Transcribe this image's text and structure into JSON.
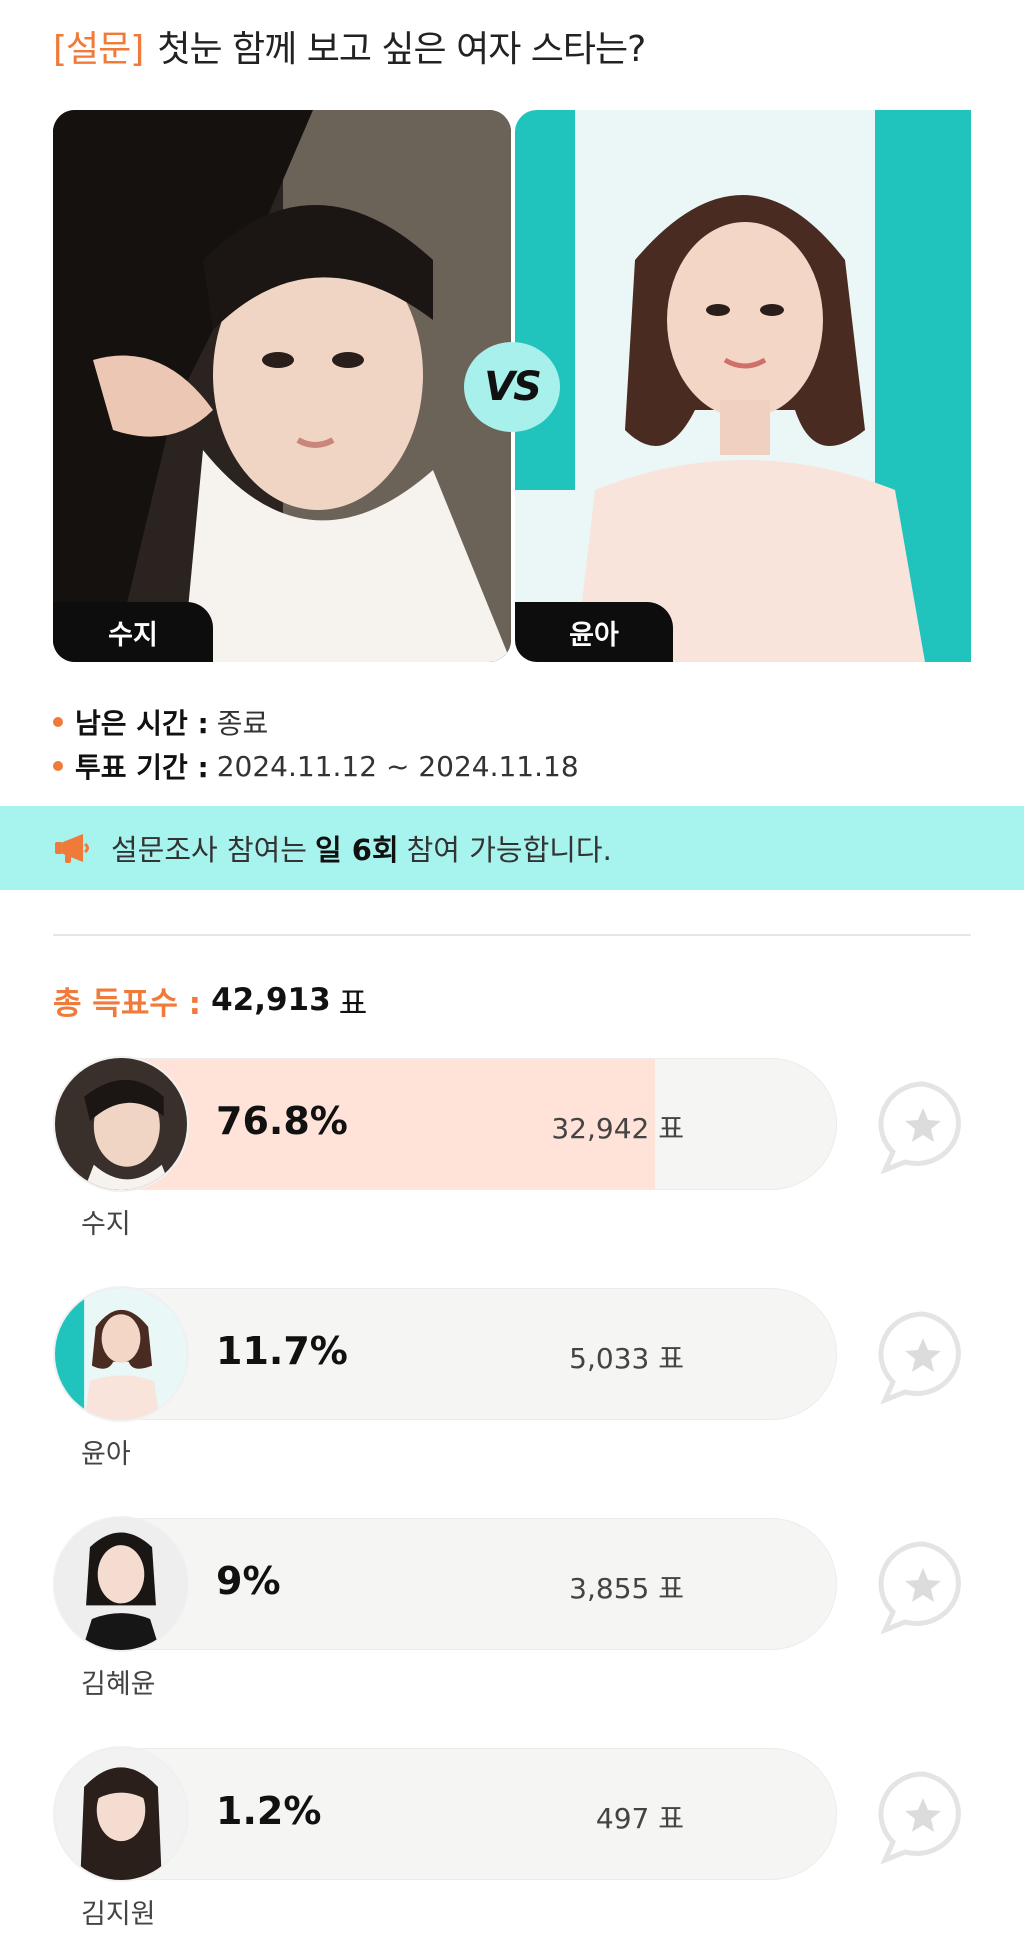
{
  "header": {
    "tag": "[설문]",
    "title": "첫눈 함께 보고 싶은 여자 스타는?"
  },
  "matchup": {
    "left_name": "수지",
    "right_name": "윤아",
    "vs_label": "VS"
  },
  "info": {
    "remaining_label": "남은 시간 :",
    "remaining_value": "종료",
    "period_label": "투표 기간 :",
    "period_value": "2024.11.12 ~ 2024.11.18"
  },
  "notice": {
    "icon": "megaphone-icon",
    "text_before": "설문조사 참여는",
    "text_bold": "일 6회",
    "text_after": "참여 가능합니다."
  },
  "total": {
    "label": "총 득표수 :",
    "value": "42,913",
    "unit": "표"
  },
  "results": [
    {
      "name": "수지",
      "percent_label": "76.8%",
      "percent": 76.8,
      "votes": "32,942 표",
      "highlight": true
    },
    {
      "name": "윤아",
      "percent_label": "11.7%",
      "percent": 11.7,
      "votes": "5,033 표",
      "highlight": false
    },
    {
      "name": "김혜윤",
      "percent_label": "9%",
      "percent": 9,
      "votes": "3,855 표",
      "highlight": false
    },
    {
      "name": "김지원",
      "percent_label": "1.2%",
      "percent": 1.2,
      "votes": "497 표",
      "highlight": false
    }
  ],
  "colors": {
    "accent": "#f07a3a",
    "mint": "#a7f3ee",
    "bar_bg": "#f5f5f4",
    "bar_fill": "#ffe3d9"
  }
}
